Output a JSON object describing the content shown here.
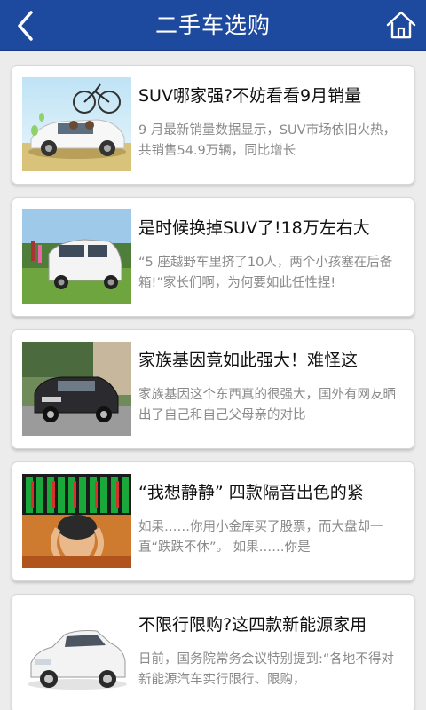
{
  "header": {
    "title": "二手车选购",
    "back_icon": "back-arrow-icon",
    "home_icon": "home-icon",
    "background": "#1d4a9e"
  },
  "articles": [
    {
      "title": "SUV哪家强?不妨看看9月销量",
      "desc": "9 月最新销量数据显示，SUV市场依旧火热，共销售54.9万辆，同比增长",
      "image": "suv-with-bicycle-photo"
    },
    {
      "title": "是时候换掉SUV了!18万左右大",
      "desc": "“5 座越野车里挤了10人，两个小孩塞在后备箱!”家长们啊，为何要如此任性捏!",
      "image": "white-minivan-photo"
    },
    {
      "title": "家族基因竟如此强大！难怪这",
      "desc": "家族基因这个东西真的很强大，国外有网友晒出了自己和自己父母亲的对比",
      "image": "dark-suv-photo"
    },
    {
      "title": "“我想静静” 四款隔音出色的紧",
      "desc": "如果……你用小金库买了股票，而大盘却一直“跌跌不休”。     如果……你是",
      "image": "stock-board-investor-photo"
    },
    {
      "title": "不限行限购?这四款新能源家用",
      "desc": "日前，国务院常务会议特别提到:“各地不得对新能源汽车实行限行、限购，",
      "image": "white-sedan-photo"
    }
  ]
}
